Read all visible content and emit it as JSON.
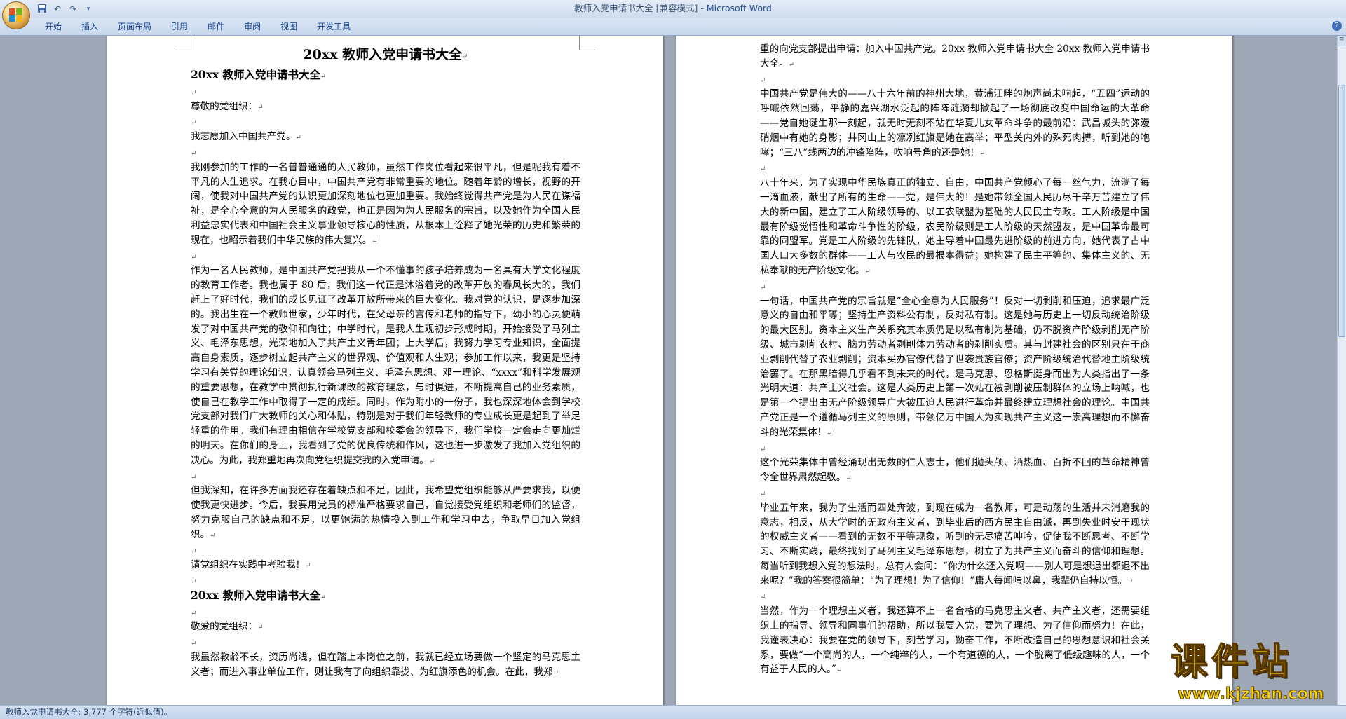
{
  "window": {
    "title_doc": "教师入党申请书大全 [兼容模式] - ",
    "title_app": "Microsoft Word"
  },
  "ribbon": {
    "tabs": [
      "开始",
      "插入",
      "页面布局",
      "引用",
      "邮件",
      "审阅",
      "视图",
      "开发工具"
    ]
  },
  "status": {
    "text": "教师入党申请书大全: 3,777 个字符(近似值)。"
  },
  "left_page": [
    {
      "t": "title",
      "text": "20xx 教师入党申请书大全"
    },
    {
      "t": "heading",
      "text": "20xx 教师入党申请书大全"
    },
    {
      "t": "blank"
    },
    {
      "t": "p",
      "text": "尊敬的党组织："
    },
    {
      "t": "blank"
    },
    {
      "t": "p",
      "text": "我志愿加入中国共产党。"
    },
    {
      "t": "blank"
    },
    {
      "t": "p",
      "text": "我刚参加的工作的一名普普通通的人民教师，虽然工作岗位看起来很平凡，但是呢我有着不平凡的人生追求。在我心目中，中国共产党有非常重要的地位。随着年龄的增长，视野的开阔，使我对中国共产党的认识更加深刻地位也更加重要。我始终觉得共产党是为人民在谋福祉，是全心全意的为人民服务的政党，也正是因为为人民服务的宗旨，以及她作为全国人民利益忠实代表和中国社会主义事业领导核心的性质，从根本上诠释了她光荣的历史和繁荣的现在，也昭示着我们中华民族的伟大复兴。"
    },
    {
      "t": "blank"
    },
    {
      "t": "p",
      "text": "作为一名人民教师，是中国共产党把我从一个不懂事的孩子培养成为一名具有大学文化程度的教育工作者。我也属于 80 后，我们这一代正是沐浴着党的改革开放的春风长大的，我们赶上了好时代，我们的成长见证了改革开放所带来的巨大变化。我对党的认识，是逐步加深的。我出生在一个教师世家，少年时代，在父母亲的言传和老师的指导下，幼小的心灵便萌发了对中国共产党的敬仰和向往；中学时代，是我人生观初步形成时期，开始接受了马列主义、毛泽东思想，光荣地加入了共产主义青年团；上大学后，我努力学习专业知识，全面提高自身素质，逐步树立起共产主义的世界观、价值观和人生观；参加工作以来，我更是坚持学习有关党的理论知识，认真领会马列主义、毛泽东思想、邓一理论、“xxxx”和科学发展观的重要思想，在教学中贯彻执行新课改的教育理念，与时俱进，不断提高自己的业务素质，使自己在教学工作中取得了一定的成绩。同时，作为附小的一份子，我也深深地体会到学校党支部对我们广大教师的关心和体贴，特别是对于我们年轻教师的专业成长更是起到了举足轻重的作用。我们有理由相信在学校党支部和校委会的领导下，我们学校一定会走向更灿烂的明天。在你们的身上，我看到了党的优良传统和作风，这也进一步激发了我加入党组织的决心。为此，我郑重地再次向党组织提交我的入党申请。"
    },
    {
      "t": "blank"
    },
    {
      "t": "p",
      "text": "但我深知，在许多方面我还存在着缺点和不足，因此，我希望党组织能够从严要求我，以便使我更快进步。今后，我要用党员的标准严格要求自己，自觉接受党组织和老师们的监督，努力克服自己的缺点和不足，以更饱满的热情投入到工作和学习中去，争取早日加入党组织。"
    },
    {
      "t": "blank"
    },
    {
      "t": "p",
      "text": "请党组织在实践中考验我！"
    },
    {
      "t": "blank"
    },
    {
      "t": "heading",
      "text": "20xx 教师入党申请书大全"
    },
    {
      "t": "blank"
    },
    {
      "t": "p",
      "text": "敬爱的党组织："
    },
    {
      "t": "blank"
    },
    {
      "t": "p",
      "text": "我虽然教龄不长，资历尚浅，但在踏上本岗位之前，我就已经立场要做一个坚定的马克思主义者；而进入事业单位工作，则让我有了向组织靠拢、为红旗添色的机会。在此，我郑"
    }
  ],
  "right_page": [
    {
      "t": "p",
      "text": "重的向党支部提出申请：加入中国共产党。20xx 教师入党申请书大全 20xx 教师入党申请书大全。"
    },
    {
      "t": "blank"
    },
    {
      "t": "p",
      "text": "中国共产党是伟大的——八十六年前的神州大地，黄浦江畔的炮声尚未响起，“五四”运动的呼喊依然回荡，平静的嘉兴湖水泛起的阵阵涟漪却掀起了一场彻底改变中国命运的大革命——党自她诞生那一刻起，就无时无刻不站在华夏儿女革命斗争的最前沿：武昌城头的弥漫硝烟中有她的身影；井冈山上的凛冽红旗是她在高举；平型关内外的殊死肉搏，听到她的咆哮；“三八”线两边的冲锋陷阵，吹响号角的还是她！"
    },
    {
      "t": "blank"
    },
    {
      "t": "p",
      "text": "八十年来，为了实现中华民族真正的独立、自由，中国共产党倾心了每一丝气力，流淌了每一滴血液，献出了所有的生命——党，是伟大的！是她带领全国人民历尽千辛万苦建立了伟大的新中国，建立了工人阶级领导的、以工农联盟为基础的人民民主专政。工人阶级是中国最有阶级觉悟性和革命斗争性的阶级，农民阶级则是工人阶级的天然盟友，是中国革命最可靠的同盟军。党是工人阶级的先锋队，她主导着中国最先进阶级的前进方向，她代表了占中国人口大多数的群体——工人与农民的最根本得益；她构建了民主平等的、集体主义的、无私奉献的无产阶级文化。"
    },
    {
      "t": "blank"
    },
    {
      "t": "p",
      "text": "一句话，中国共产党的宗旨就是“全心全意为人民服务”！反对一切剥削和压迫，追求最广泛意义的自由和平等；坚持生产资料公有制，反对私有制。这是她与历史上一切反动统治阶级的最大区别。资本主义生产关系究其本质仍是以私有制为基础，仍不脱资产阶级剥削无产阶级、城市剥削农村、脑力劳动者剥削体力劳动者的剥削实质。其与封建社会的区别只在于商业剥削代替了农业剥削；资本买办官僚代替了世袭贵族官僚；资产阶级统治代替地主阶级统治罢了。在那黑暗得几乎看不到未来的时代，是马克思、恩格斯挺身而出为人类指出了一条光明大道：共产主义社会。这是人类历史上第一次站在被剥削被压制群体的立场上呐喊，也是第一个提出由无产阶级领导广大被压迫人民进行革命并最终建立理想社会的理论。中国共产党正是一个遵循马列主义的原则，带领亿万中国人为实现共产主义这一崇高理想而不懈奋斗的光荣集体！"
    },
    {
      "t": "blank"
    },
    {
      "t": "p",
      "text": "这个光荣集体中曾经涌现出无数的仁人志士，他们抛头颅、洒热血、百折不回的革命精神曾令全世界肃然起敬。"
    },
    {
      "t": "blank"
    },
    {
      "t": "p",
      "text": "毕业五年来，我为了生活而四处奔波，到现在成为一名教师，可是动荡的生活并未消磨我的意志，相反，从大学时的无政府主义者，到毕业后的西方民主自由派，再到失业时安于现状的权威主义者——看到的无数不平等现象，听到的无尽痛苦呻吟，促使我不断思考、不断学习、不断实践，最终找到了马列主义毛泽东思想，树立了为共产主义而奋斗的信仰和理想。每当听到我想入党的想法时，总有人会问：“你为什么还入党啊——别人可是想退出都退不出来呢？”我的答案很简单：“为了理想！为了信仰！”庸人每闻嗤以鼻，我辈仍自持以恒。"
    },
    {
      "t": "blank"
    },
    {
      "t": "p",
      "text": "当然，作为一个理想主义者，我还算不上一名合格的马克思主义者、共产主义者，还需要组织上的指导、领导和同事们的帮助，所以我要入党，要为了理想、为了信仰而努力！在此，我谨表决心：我要在党的领导下，刻苦学习，勤奋工作，不断改造自己的思想意识和社会关系，要做“一个高尚的人，一个纯粹的人，一个有道德的人，一个脱离了低级趣味的人，一个有益于人民的人。”"
    }
  ],
  "watermark": {
    "logo": "课件站",
    "url": "www.kjzhan.com"
  }
}
